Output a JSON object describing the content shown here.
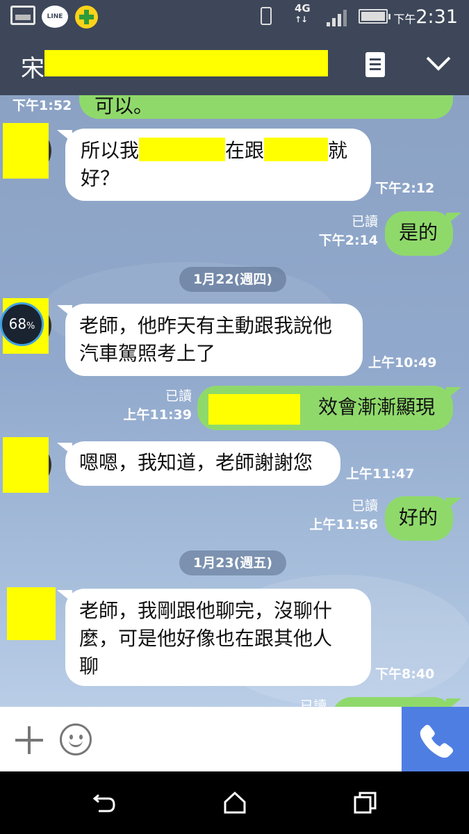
{
  "status_bar": {
    "line_label": "LINE",
    "network": "4G",
    "time_prefix": "下午",
    "time": "2:31"
  },
  "header": {
    "title": "宋",
    "memo_icon": "memo-icon",
    "collapse_icon": "chevron-down-icon"
  },
  "badge": {
    "value": "68",
    "unit": "%"
  },
  "messages": {
    "m0": {
      "text": "可以。",
      "time": "下午1:52"
    },
    "m1": {
      "text_a": "所以我",
      "text_b": "在跟",
      "text_c": "就",
      "text_d": "好？",
      "time": "下午2:12"
    },
    "m2": {
      "text": "是的",
      "read": "已讀",
      "time": "下午2:14"
    },
    "d1": "1月22(週四)",
    "m3": {
      "line1": "老師，他昨天有主動跟我說他",
      "line2": "汽車駕照考上了",
      "time": "上午10:49"
    },
    "m4": {
      "text": "效會漸漸顯現",
      "read": "已讀",
      "time": "上午11:39"
    },
    "m5": {
      "text": "嗯嗯，我知道，老師謝謝您",
      "time": "上午11:47"
    },
    "m6": {
      "text": "好的",
      "read": "已讀",
      "time": "上午11:56"
    },
    "d2": "1月23(週五)",
    "m7": {
      "line1": "老師，我剛跟他聊完，沒聊什",
      "line2": "麼，可是他好像也在跟其他人",
      "line3": "聊",
      "time": "下午8:40"
    },
    "m8": {
      "read": "已讀"
    }
  },
  "input_bar": {
    "plus_icon": "plus-icon",
    "emoji_icon": "smiley-icon",
    "call_icon": "phone-icon"
  },
  "colors": {
    "header": "#3d4759",
    "outgoing": "#8fd96b",
    "incoming": "#ffffff",
    "call": "#4f7ee3"
  }
}
